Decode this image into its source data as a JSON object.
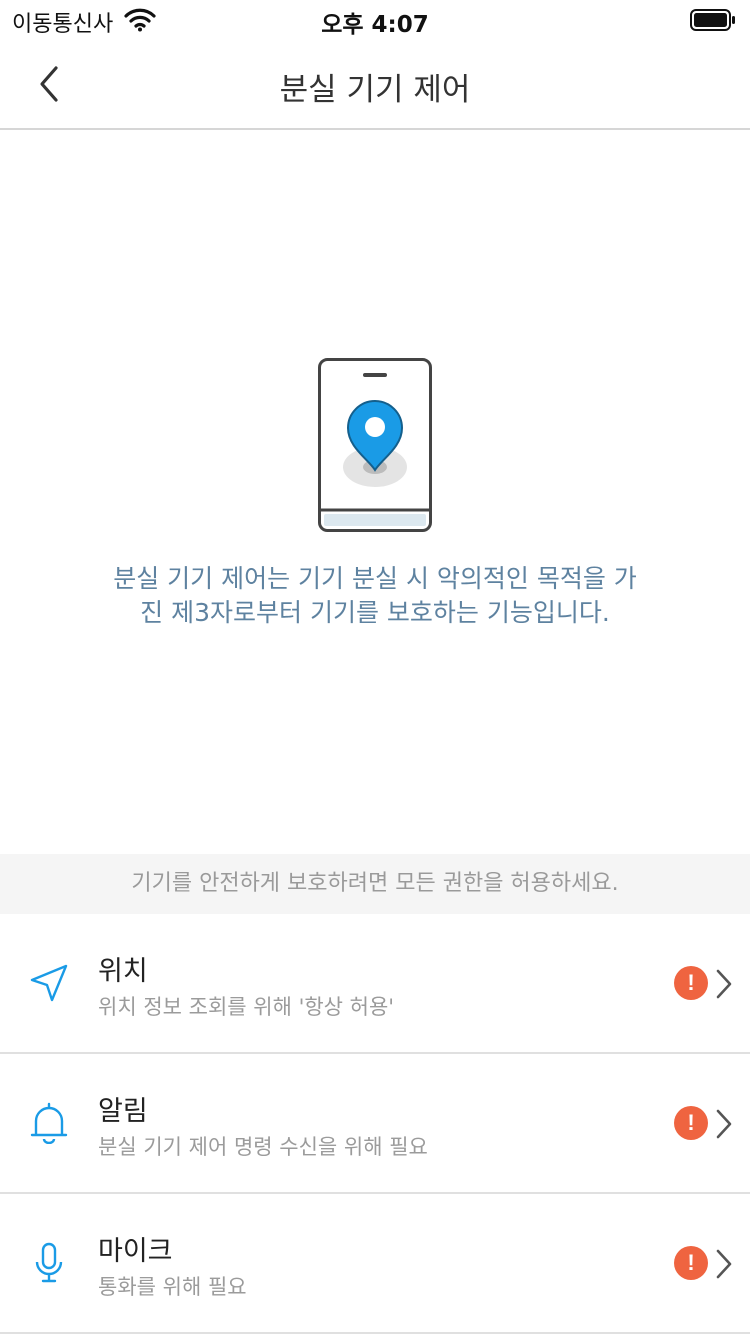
{
  "status_bar": {
    "carrier": "이동통신사",
    "time": "오후 4:07"
  },
  "nav": {
    "title": "분실 기기 제어"
  },
  "hero": {
    "description_line1": "분실 기기 제어는 기기 분실 시 악의적인 목적을 가",
    "description_line2": "진 제3자로부터 기기를 보호하는 기능입니다."
  },
  "notice": "기기를 안전하게 보호하려면 모든 권한을 허용하세요.",
  "permissions": [
    {
      "title": "위치",
      "subtitle": "위치 정보 조회를 위해 '항상 허용'",
      "icon": "location-arrow-icon",
      "badge": "!"
    },
    {
      "title": "알림",
      "subtitle": "분실 기기 제어 명령 수신을 위해 필요",
      "icon": "bell-icon",
      "badge": "!"
    },
    {
      "title": "마이크",
      "subtitle": "통화를 위해 필요",
      "icon": "microphone-icon",
      "badge": "!"
    }
  ],
  "colors": {
    "accent": "#1a9be6",
    "description_text": "#5e82a0",
    "warning": "#ef6440",
    "notice_bg": "#f5f5f5"
  }
}
